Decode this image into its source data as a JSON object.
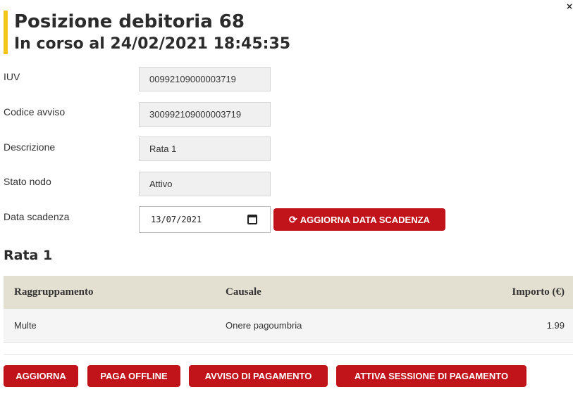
{
  "header": {
    "close_label": "×",
    "title": "Posizione debitoria 68",
    "subtitle": "In corso al 24/02/2021 18:45:35"
  },
  "fields": {
    "iuv": {
      "label": "IUV",
      "value": "00992109000003719"
    },
    "codice_avviso": {
      "label": "Codice avviso",
      "value": "300992109000003719"
    },
    "descrizione": {
      "label": "Descrizione",
      "value": "Rata 1"
    },
    "stato_nodo": {
      "label": "Stato nodo",
      "value": "Attivo"
    },
    "data_scadenza": {
      "label": "Data scadenza",
      "value": "13/07/2021"
    }
  },
  "update_date_button": {
    "icon": "refresh-icon",
    "label": "AGGIORNA DATA SCADENZA"
  },
  "section": {
    "title": "Rata 1"
  },
  "table": {
    "headers": [
      "Raggruppamento",
      "Causale",
      "Importo (€)"
    ],
    "rows": [
      [
        "Multe",
        "Onere pagoumbria",
        "1.99"
      ]
    ]
  },
  "actions": {
    "aggiorna": "AGGIORNA",
    "paga_offline": "PAGA OFFLINE",
    "avviso": "AVVISO DI PAGAMENTO",
    "sessione": "ATTIVA SESSIONE DI PAGAMENTO"
  },
  "colors": {
    "accent_yellow": "#f5c518",
    "button_red": "#c0131a",
    "table_header_bg": "#e3e0d1"
  }
}
